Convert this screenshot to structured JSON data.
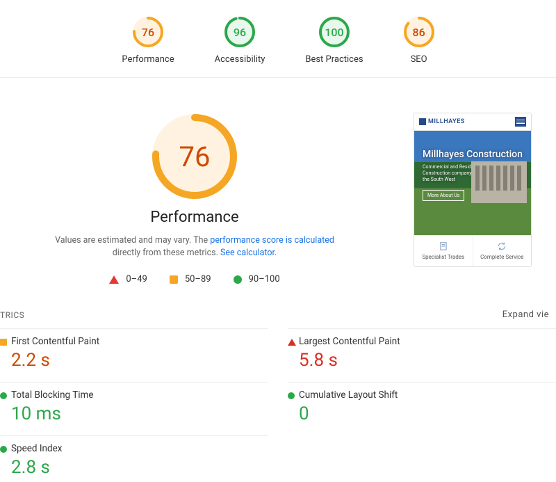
{
  "scores": [
    {
      "label": "Performance",
      "value": 76,
      "color": "#f5a623",
      "fill": "#fff2e0",
      "text": "#d04900",
      "deg": 274
    },
    {
      "label": "Accessibility",
      "value": 96,
      "color": "#2ba84a",
      "fill": "#e9f8ed",
      "text": "#2ba84a",
      "deg": 346
    },
    {
      "label": "Best Practices",
      "value": 100,
      "color": "#2ba84a",
      "fill": "#e9f8ed",
      "text": "#2ba84a",
      "deg": 360
    },
    {
      "label": "SEO",
      "value": 86,
      "color": "#f5a623",
      "fill": "#fff2e0",
      "text": "#d04900",
      "deg": 310
    }
  ],
  "hero": {
    "score": 76,
    "title": "Performance",
    "color": "#f5a623",
    "fill": "#fff2e0",
    "deg": 274,
    "note_prefix": "Values are estimated and may vary. The ",
    "note_link1": "performance score is calculated",
    "note_mid": " directly from these metrics. ",
    "note_link2": "See calculator"
  },
  "legend": {
    "poor": "0–49",
    "mid": "50–89",
    "good": "90–100"
  },
  "preview": {
    "brand": "MILLHAYES",
    "title": "Millhayes Construction",
    "sub": "Commercial and Residential Construction company based in the South West",
    "btn": "More About Us",
    "card1": "Specialist Trades",
    "card2": "Complete Service"
  },
  "metrics_header": {
    "left": "TRICS",
    "right": "Expand vie"
  },
  "metrics": [
    {
      "name": "First Contentful Paint",
      "value": "2.2 s",
      "status": "orange",
      "shape": "sq"
    },
    {
      "name": "Largest Contentful Paint",
      "value": "5.8 s",
      "status": "red",
      "shape": "tri"
    },
    {
      "name": "Total Blocking Time",
      "value": "10 ms",
      "status": "green",
      "shape": "ci"
    },
    {
      "name": "Cumulative Layout Shift",
      "value": "0",
      "status": "green",
      "shape": "ci"
    },
    {
      "name": "Speed Index",
      "value": "2.8 s",
      "status": "green",
      "shape": "ci"
    }
  ]
}
